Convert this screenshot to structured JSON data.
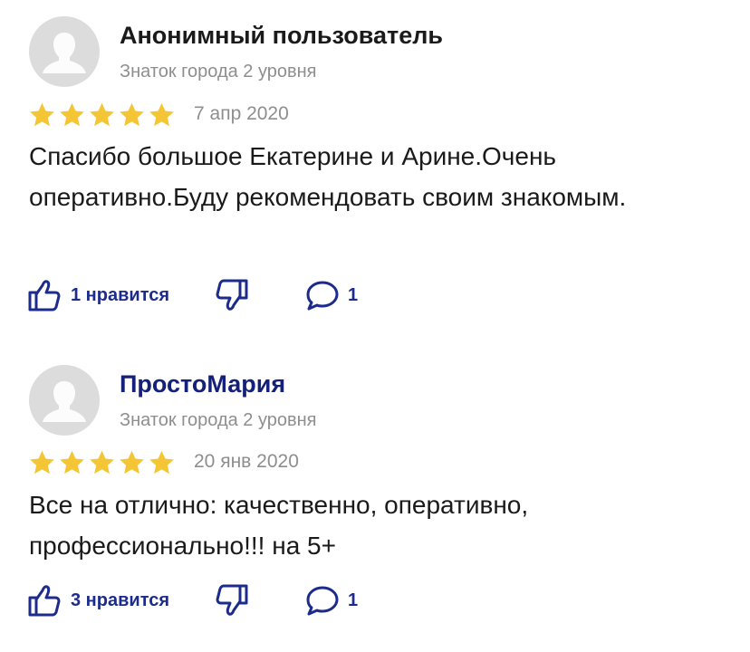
{
  "reviews": [
    {
      "author": "Анонимный пользователь",
      "level": "Знаток города 2 уровня",
      "rating": 5,
      "date": "7 апр 2020",
      "text": "Спасибо большое Екатерине и Арине.Очень оперативно.Буду рекомендовать своим знакомым.",
      "likes_label": "1 нравится",
      "comments_count": "1"
    },
    {
      "author": "ПростоМария",
      "level": "Знаток города 2 уровня",
      "rating": 5,
      "date": "20 янв 2020",
      "text": "Все на отлично: качественно, оперативно, профессионально!!! на 5+",
      "likes_label": "3 нравится",
      "comments_count": "1"
    }
  ],
  "colors": {
    "star": "#f4c534",
    "action": "#1d2c8c",
    "author_link": "#152078",
    "meta": "#8e8e8e"
  },
  "icons": {
    "like": "thumbs-up-icon",
    "dislike": "thumbs-down-icon",
    "comment": "comment-bubble-icon",
    "avatar": "user-silhouette-icon",
    "star": "star-icon"
  }
}
